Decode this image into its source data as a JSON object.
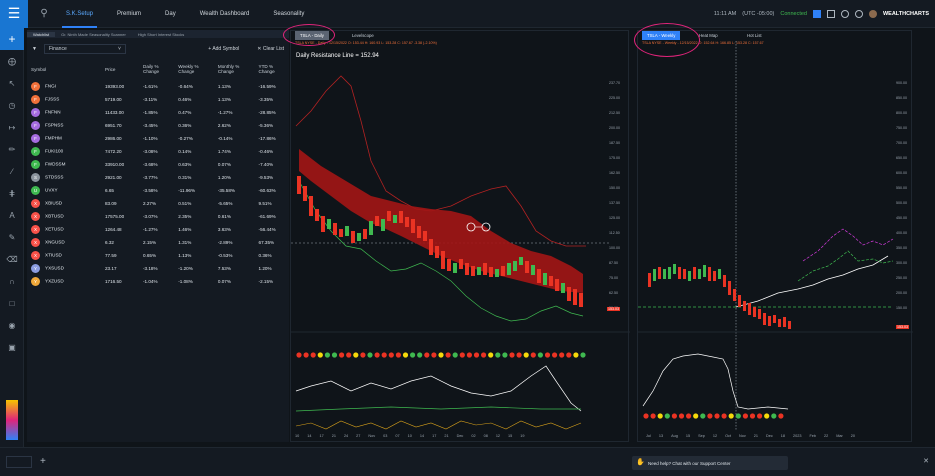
{
  "topbar": {
    "tabs": [
      "S.K.Setup",
      "Premium",
      "Day",
      "Wealth Dashboard",
      "Seasonality"
    ],
    "time": "11:11 AM",
    "timezone": "(UTC -05:00)",
    "status": "Connected",
    "brand": "WEALTHCHARTS"
  },
  "watchlist": {
    "tabs": [
      "Watchlist",
      "Gr. Ninth Made Seasonality Scanner",
      "High Short Interest Stocks"
    ],
    "select": "Finance",
    "add_symbol": "Add Symbol",
    "clear_list": "Clear List",
    "columns": [
      "Symbol",
      "Price",
      "Daily % Change",
      "Weekly % Change",
      "Monthly % Change",
      "YTD % Change"
    ],
    "rows": [
      {
        "sym": "FNGI",
        "c": "#f0703a",
        "price": "19393.00",
        "d": "-1.61%",
        "w": "-0.64%",
        "m": "1.13%",
        "y": "-16.59%"
      },
      {
        "sym": "FJSSS",
        "c": "#f0703a",
        "price": "5719.00",
        "d": "-3.11%",
        "w": "0.46%",
        "m": "1.13%",
        "y": "-3.35%"
      },
      {
        "sym": "FNFNN",
        "c": "#a56ce0",
        "price": "11433.00",
        "d": "-1.85%",
        "w": "0.47%",
        "m": "-1.27%",
        "y": "-28.85%"
      },
      {
        "sym": "FSPNSS",
        "c": "#a56ce0",
        "price": "6951.70",
        "d": "-3.45%",
        "w": "0.36%",
        "m": "2.62%",
        "y": "-5.36%"
      },
      {
        "sym": "FMPHM",
        "c": "#a56ce0",
        "price": "2986.00",
        "d": "-1.10%",
        "w": "-0.27%",
        "m": "-0.14%",
        "y": "-17.86%"
      },
      {
        "sym": "FUKI100",
        "c": "#3fb950",
        "price": "7472.20",
        "d": "-3.08%",
        "w": "0.14%",
        "m": "1.74%",
        "y": "-0.46%"
      },
      {
        "sym": "FWDSSM",
        "c": "#3fb950",
        "price": "33910.00",
        "d": "-3.68%",
        "w": "0.63%",
        "m": "0.07%",
        "y": "-7.40%"
      },
      {
        "sym": "STDSSS",
        "c": "#8b949e",
        "price": "2921.00",
        "d": "-3.77%",
        "w": "0.31%",
        "m": "1.20%",
        "y": "-9.53%"
      },
      {
        "sym": "UVXY",
        "c": "#3fb950",
        "price": "6.65",
        "d": "-3.58%",
        "w": "-11.96%",
        "m": "-35.58%",
        "y": "-60.63%"
      },
      {
        "sym": "XBIUSD",
        "c": "#f85149",
        "price": "83.09",
        "d": "2.27%",
        "w": "0.51%",
        "m": "-5.65%",
        "y": "9.51%"
      },
      {
        "sym": "XBTUSD",
        "c": "#f85149",
        "price": "17575.00",
        "d": "-3.07%",
        "w": "2.35%",
        "m": "0.61%",
        "y": "-61.69%"
      },
      {
        "sym": "XETUSD",
        "c": "#f85149",
        "price": "1264.48",
        "d": "-1.27%",
        "w": "1.46%",
        "m": "3.63%",
        "y": "-56.44%"
      },
      {
        "sym": "XNGUSD",
        "c": "#f85149",
        "price": "6.32",
        "d": "2.15%",
        "w": "1.31%",
        "m": "-2.89%",
        "y": "67.35%"
      },
      {
        "sym": "XTIUSD",
        "c": "#f85149",
        "price": "77.59",
        "d": "0.65%",
        "w": "1.13%",
        "m": "-0.53%",
        "y": "0.36%"
      },
      {
        "sym": "YXSUSD",
        "c": "#8b9ce0",
        "price": "23.17",
        "d": "-3.18%",
        "w": "-1.20%",
        "m": "7.53%",
        "y": "1.20%"
      },
      {
        "sym": "YXZUSD",
        "c": "#f0a83a",
        "price": "1716.50",
        "d": "-1.04%",
        "w": "-1.08%",
        "m": "0.07%",
        "y": "-2.15%"
      }
    ]
  },
  "chart_daily": {
    "tab_label": "TSLA - Daily",
    "tab2": "Levelscope",
    "subtitle": "TSLA NYSE - Daily - 12/15/2022 O: 153.44 H: 160.93 L: 153.28 C: 157.67 -3.38 (-2.10%)",
    "annotation": "Daily Resistance Line = 152.94",
    "price_ticks": [
      "237.70",
      "225.00",
      "212.50",
      "200.00",
      "187.50",
      "175.00",
      "162.50",
      "150.00",
      "137.50",
      "125.00",
      "112.50",
      "100.00",
      "87.50",
      "75.00",
      "62.50",
      "50.00"
    ],
    "last_price": "153.03",
    "x_ticks": [
      "10",
      "14",
      "17",
      "21",
      "24",
      "27",
      "Nov",
      "03",
      "07",
      "10",
      "14",
      "17",
      "21",
      "Dec",
      "02",
      "08",
      "12",
      "15",
      "19"
    ]
  },
  "chart_weekly": {
    "tab_label": "TSLA - Weekly",
    "tab2": "Heat Map",
    "tab3": "Hot List",
    "subtitle": "TSLA NYSE - Weekly - 12/15/2022 O: 152.64 H: 166.85 L: 153.28 C: 157.67",
    "price_ticks": [
      "900.00",
      "850.00",
      "800.00",
      "750.00",
      "700.00",
      "650.00",
      "600.00",
      "550.00",
      "500.00",
      "450.00",
      "400.00",
      "350.00",
      "300.00",
      "250.00",
      "200.00",
      "150.00"
    ],
    "last_price": "153.03",
    "x_ticks": [
      "Jul",
      "13",
      "Aug",
      "15",
      "Sep",
      "12",
      "Oct",
      "Nov",
      "21",
      "Dec",
      "18",
      "2023",
      "Feb",
      "22",
      "Mar",
      "20"
    ]
  },
  "bottom": {
    "toast": "Need help? Chat with our Support Center"
  }
}
